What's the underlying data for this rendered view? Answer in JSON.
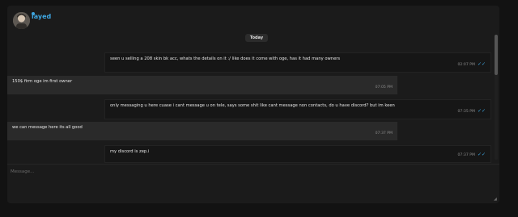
{
  "header": {
    "username": "layed",
    "avatar_icon": "user-avatar"
  },
  "chat": {
    "date_divider": "Today",
    "messages": [
      {
        "direction": "out",
        "text": "seen u selling a 208 skin bk acc, whats the details on it :/ like does it come with oge, has it had many owners",
        "time": "02:07 PM",
        "status": "read"
      },
      {
        "direction": "in",
        "text": "150$ firm oge im first owner",
        "time": "07:05 PM"
      },
      {
        "direction": "out",
        "text": "only messaging u here cuase i cant message u on tele, says some shit like cant message non contacts, do u have discord? but im keen",
        "time": "07:35 PM",
        "status": "read"
      },
      {
        "direction": "in",
        "text": "we can message here its all good",
        "time": "07:37 PM"
      },
      {
        "direction": "out",
        "text": "my discord is zep.i",
        "time": "07:37 PM",
        "status": "read"
      }
    ]
  },
  "composer": {
    "placeholder": "Message..."
  },
  "colors": {
    "accent": "#3ea6e0",
    "background": "#121212",
    "panel": "#1b1b1b"
  }
}
